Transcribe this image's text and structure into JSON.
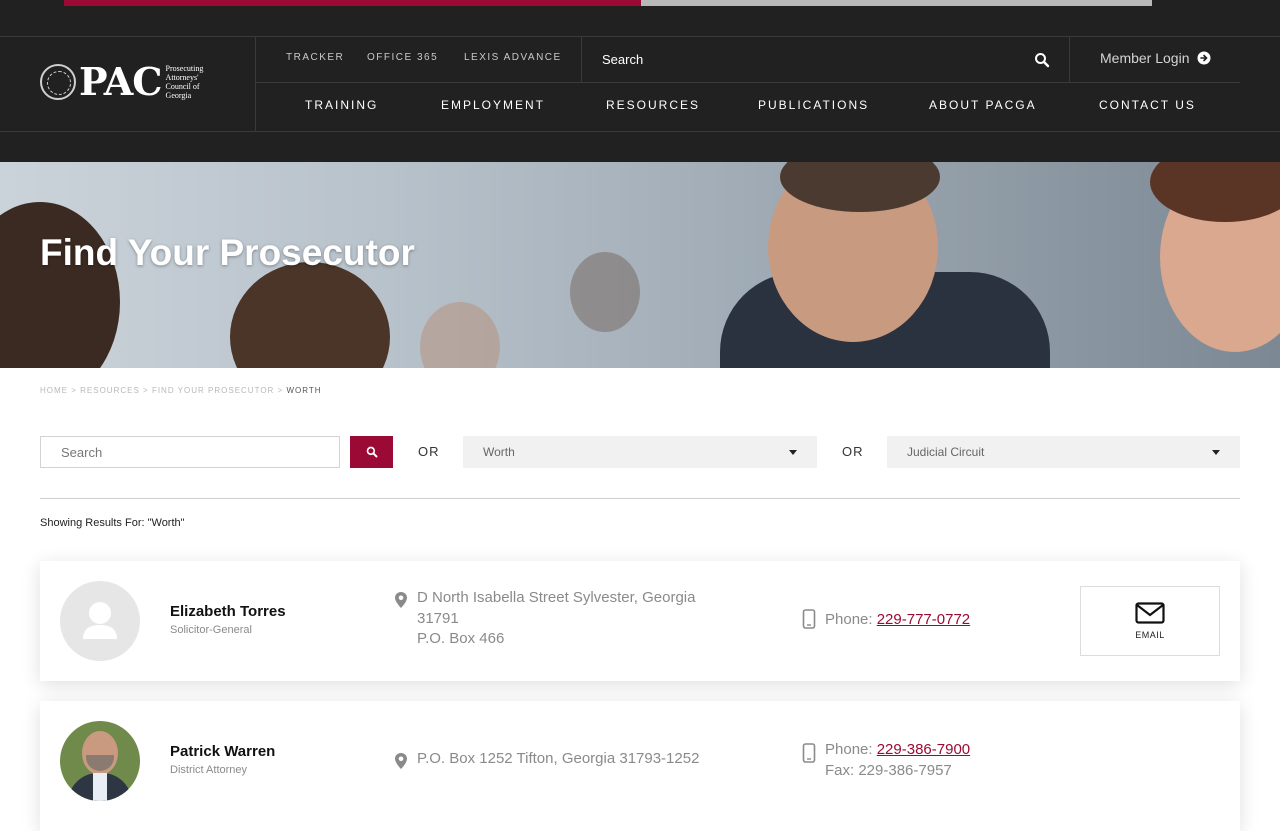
{
  "reading_progress_fraction": 0.53,
  "header": {
    "logo_text": "PAC",
    "logo_subtitle": "Prosecuting Attorneys' Council of Georgia",
    "util_links": [
      "TRACKER",
      "OFFICE 365",
      "LEXIS ADVANCE"
    ],
    "search_label": "Search",
    "member_login": "Member Login",
    "nav": [
      "TRAINING",
      "EMPLOYMENT",
      "RESOURCES",
      "PUBLICATIONS",
      "ABOUT PACGA",
      "CONTACT US"
    ]
  },
  "hero": {
    "title": "Find Your Prosecutor"
  },
  "breadcrumb": [
    "HOME",
    "RESOURCES",
    "FIND YOUR PROSECUTOR",
    "WORTH"
  ],
  "filters": {
    "search_placeholder": "Search",
    "or_label": "OR",
    "county_selected": "Worth",
    "circuit_selected": "Judicial Circuit"
  },
  "results_label": "Showing Results For: \"Worth\"",
  "results": [
    {
      "name": "Elizabeth Torres",
      "title": "Solicitor-General",
      "address_lines": [
        "D North Isabella Street Sylvester, Georgia",
        "31791",
        "P.O. Box 466"
      ],
      "phone_label": "Phone:",
      "phone": "229-777-0772",
      "email_label": "EMAIL"
    },
    {
      "name": "Patrick Warren",
      "title": "District Attorney",
      "address_lines": [
        "P.O. Box 1252 Tifton, Georgia 31793-1252"
      ],
      "phone_label": "Phone:",
      "phone": "229-386-7900",
      "fax": "Fax: 229-386-7957"
    }
  ],
  "colors": {
    "accent": "#9a0a34",
    "header_bg": "#212121"
  }
}
